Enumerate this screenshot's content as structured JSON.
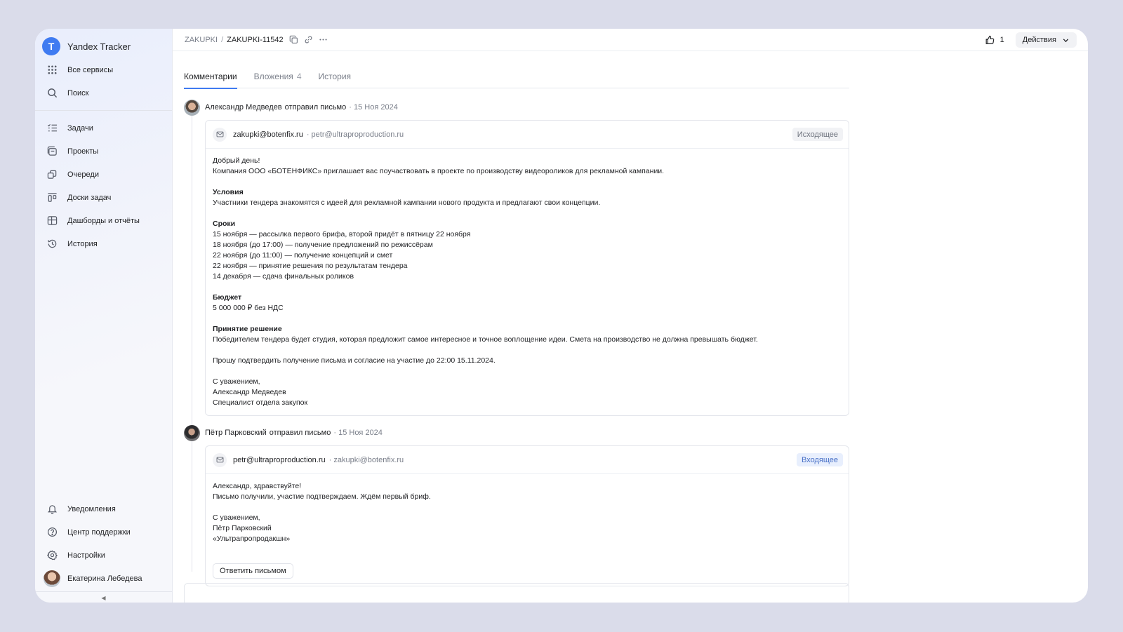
{
  "sidebar": {
    "brand": "Yandex Tracker",
    "top_items": [
      {
        "label": "Все сервисы",
        "icon": "grid-icon"
      },
      {
        "label": "Поиск",
        "icon": "search-icon"
      }
    ],
    "main_items": [
      {
        "label": "Задачи",
        "icon": "tasks-icon"
      },
      {
        "label": "Проекты",
        "icon": "projects-icon"
      },
      {
        "label": "Очереди",
        "icon": "queues-icon"
      },
      {
        "label": "Доски задач",
        "icon": "boards-icon"
      },
      {
        "label": "Дашборды и отчёты",
        "icon": "dashboards-icon"
      },
      {
        "label": "История",
        "icon": "history-icon"
      }
    ],
    "bottom_items": [
      {
        "label": "Уведомления",
        "icon": "bell-icon"
      },
      {
        "label": "Центр поддержки",
        "icon": "help-icon"
      },
      {
        "label": "Настройки",
        "icon": "gear-icon"
      }
    ],
    "user": "Екатерина Лебедева",
    "collapse_glyph": "◀"
  },
  "header": {
    "breadcrumb_queue": "ZAKUPKI",
    "breadcrumb_sep": "/",
    "breadcrumb_key": "ZAKUPKI-11542",
    "likes": "1",
    "actions_label": "Действия"
  },
  "tabs": [
    {
      "label": "Комментарии",
      "count": ""
    },
    {
      "label": "Вложения",
      "count": "4"
    },
    {
      "label": "История",
      "count": ""
    }
  ],
  "comments": [
    {
      "author": "Александр Медведев",
      "action": "отправил письмо",
      "date": "· 15 Ноя 2024",
      "from": "zakupki@botenfix.ru",
      "to": "· petr@ultraproproduction.ru",
      "badge": "Исходящее",
      "body": {
        "greeting": "Добрый день!",
        "intro": "Компания ООО «БОТЕНФИКС» приглашает вас поучаствовать в проекте по производству видеороликов для рекламной кампании.",
        "conditions_title": "Условия",
        "conditions_text": "Участники тендера знакомятся с идеей для рекламной кампании нового продукта и предлагают свои концепции.",
        "terms_title": "Сроки",
        "terms": [
          "15 ноября — рассылка первого брифа, второй придёт в пятницу 22 ноября",
          "18 ноября (до 17:00) — получение предложений по режиссёрам",
          "22 ноября (до 11:00) — получение концепций и смет",
          "22 ноября — принятие решения по результатам тендера",
          "14 декабря — сдача финальных роликов"
        ],
        "budget_title": "Бюджет",
        "budget_text": "5 000 000 ₽ без НДС",
        "decision_title": "Принятие решение",
        "decision_text": "Победителем тендера будет студия, которая предложит самое интересное и точное воплощение идеи. Смета на производство не должна превышать бюджет.",
        "confirm": "Прошу подтвердить получение письма и согласие на участие до 22:00 15.11.2024.",
        "regards": "С уважением,",
        "sign_name": "Александр Медведев",
        "sign_role": "Специалист отдела закупок"
      }
    },
    {
      "author": "Пётр Парковский",
      "action": "отправил письмо",
      "date": "· 15 Ноя 2024",
      "from": "petr@ultraproproduction.ru",
      "to": "· zakupki@botenfix.ru",
      "badge": "Входящее",
      "body": {
        "greeting": "Александр, здравствуйте!",
        "text": "Письмо получили, участие подтверждаем. Ждём первый бриф.",
        "regards": "С уважением,",
        "sign_name": "Пётр Парковский",
        "sign_company": "«Ультрапропродакшн»"
      },
      "reply_label": "Ответить письмом"
    }
  ]
}
